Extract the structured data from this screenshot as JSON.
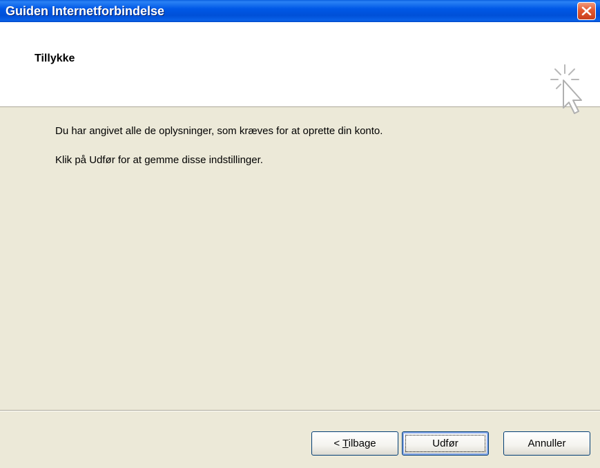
{
  "window": {
    "title": "Guiden Internetforbindelse"
  },
  "header": {
    "title": "Tillykke"
  },
  "content": {
    "line1": "Du har angivet alle de oplysninger, som kræves for at oprette din konto.",
    "line2": "Klik på Udfør for at gemme disse indstillinger."
  },
  "buttons": {
    "back_prefix": "< ",
    "back_mnemonic": "T",
    "back_rest": "ilbage",
    "finish": "Udfør",
    "cancel": "Annuller"
  },
  "icons": {
    "close": "close-icon",
    "wizard": "cursor-click-icon"
  },
  "colors": {
    "titlebar": "#0058e6",
    "close": "#e3582f",
    "dialog_bg": "#ece9d8"
  }
}
